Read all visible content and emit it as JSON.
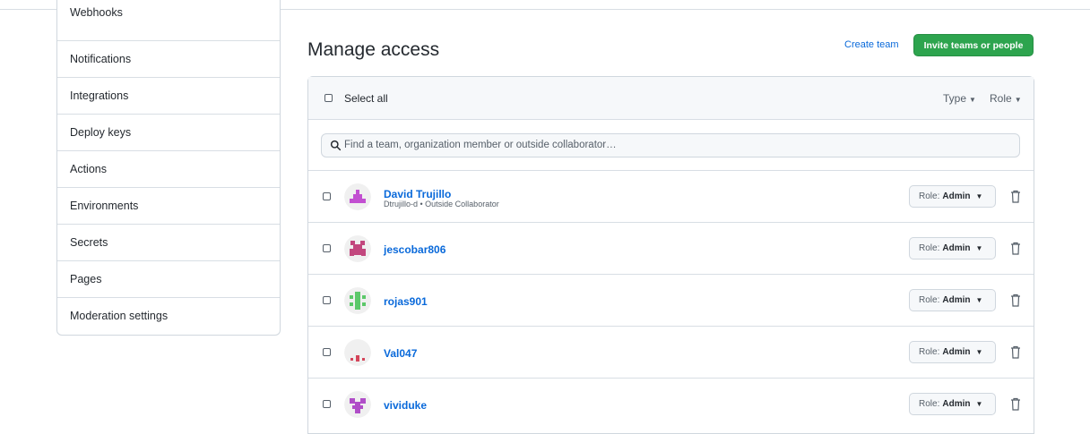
{
  "sidebar": {
    "items": [
      {
        "label": "Webhooks"
      },
      {
        "label": "Notifications"
      },
      {
        "label": "Integrations"
      },
      {
        "label": "Deploy keys"
      },
      {
        "label": "Actions"
      },
      {
        "label": "Environments"
      },
      {
        "label": "Secrets"
      },
      {
        "label": "Pages"
      },
      {
        "label": "Moderation settings"
      }
    ]
  },
  "header": {
    "title": "Manage access",
    "create_team": "Create team",
    "invite_button": "Invite teams or people"
  },
  "list": {
    "select_all": "Select all",
    "type_filter": "Type",
    "role_filter": "Role",
    "search_placeholder": "Find a team, organization member or outside collaborator…",
    "role_prefix": "Role:",
    "members": [
      {
        "name": "David Trujillo",
        "sub": "Dtrujillo-d • Outside Collaborator",
        "role": "Admin",
        "avatar_color": "#c24fd1"
      },
      {
        "name": "jescobar806",
        "sub": "",
        "role": "Admin",
        "avatar_color": "#c2477e"
      },
      {
        "name": "rojas901",
        "sub": "",
        "role": "Admin",
        "avatar_color": "#5cc86a"
      },
      {
        "name": "Val047",
        "sub": "",
        "role": "Admin",
        "avatar_color": "#d4455a"
      },
      {
        "name": "vividuke",
        "sub": "",
        "role": "Admin",
        "avatar_color": "#b04ec8"
      }
    ]
  },
  "colors": {
    "primary_green": "#2da44e",
    "link_blue": "#0969da",
    "border": "#d0d7de"
  }
}
